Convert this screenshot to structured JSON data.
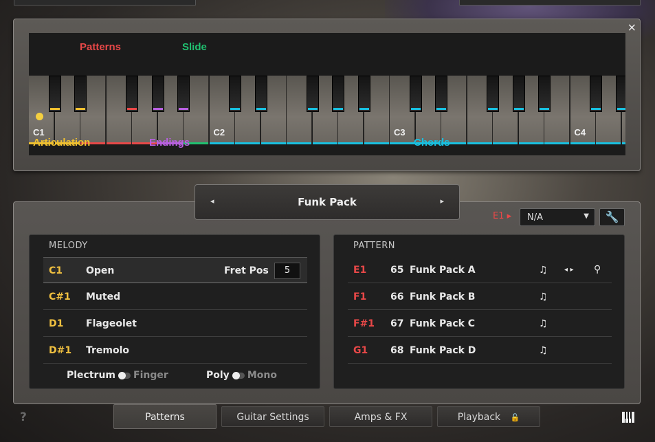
{
  "keyboard": {
    "close_label": "×",
    "zones": {
      "patterns": "Patterns",
      "slide": "Slide",
      "articulation": "Articulation",
      "endings": "Endings",
      "chords": "Chords"
    },
    "octaves": [
      "C1",
      "C2",
      "C3",
      "C4"
    ],
    "colors": {
      "articulation": "#f0c030",
      "patterns": "#e84848",
      "endings": "#b860e0",
      "slide": "#20c070",
      "chords": "#18c0e0"
    }
  },
  "pack_selector": {
    "prev_icon": "◂",
    "next_icon": "▸",
    "name": "Funk Pack"
  },
  "key_assign": {
    "label": "E1 ▸",
    "value": "N/A",
    "wrench_icon": "wrench-icon"
  },
  "melody": {
    "title": "MELODY",
    "rows": [
      {
        "note": "C1",
        "name": "Open"
      },
      {
        "note": "C#1",
        "name": "Muted"
      },
      {
        "note": "D1",
        "name": "Flageolet"
      },
      {
        "note": "D#1",
        "name": "Tremolo"
      }
    ],
    "fret_label": "Fret Pos",
    "fret_value": "5",
    "toggle1_on": "Plectrum",
    "toggle1_off": "Finger",
    "toggle2_on": "Poly",
    "toggle2_off": "Mono"
  },
  "pattern": {
    "title": "PATTERN",
    "rows": [
      {
        "note": "E1",
        "num": "65",
        "name": "Funk Pack A"
      },
      {
        "note": "F1",
        "num": "66",
        "name": "Funk Pack B"
      },
      {
        "note": "F#1",
        "num": "67",
        "name": "Funk Pack C"
      },
      {
        "note": "G1",
        "num": "68",
        "name": "Funk Pack D"
      }
    ],
    "note_icon": "♫"
  },
  "tabs": {
    "help": "?",
    "items": [
      "Patterns",
      "Guitar Settings",
      "Amps & FX",
      "Playback"
    ],
    "active": "Patterns"
  }
}
